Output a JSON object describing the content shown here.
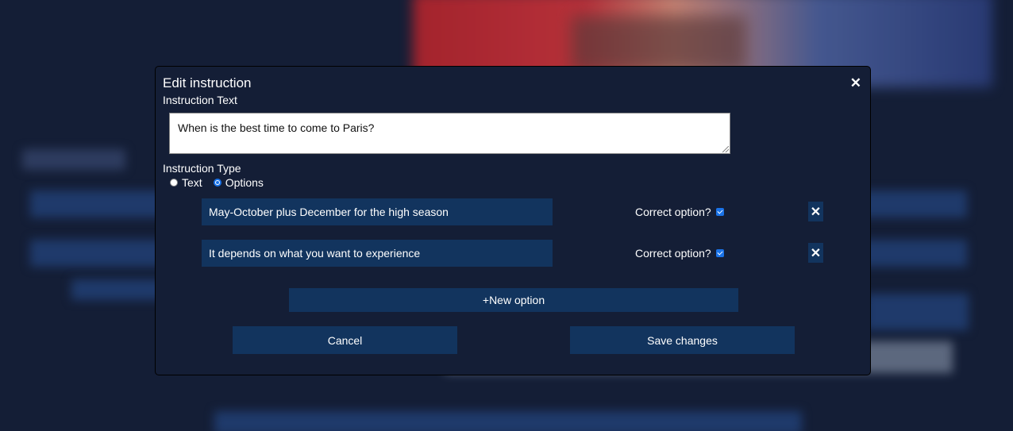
{
  "modal": {
    "title": "Edit instruction",
    "close_symbol": "✕",
    "instruction_text_label": "Instruction Text",
    "instruction_text_value": "When is the best time to come to Paris?",
    "instruction_type_label": "Instruction Type",
    "type_options": [
      {
        "label": "Text",
        "checked": false
      },
      {
        "label": "Options",
        "checked": true
      }
    ],
    "options": [
      {
        "value": "May-October plus December for the high season",
        "correct_label": "Correct option?",
        "correct": true,
        "remove_symbol": "✕"
      },
      {
        "value": "It depends on what you want to experience",
        "correct_label": "Correct option?",
        "correct": true,
        "remove_symbol": "✕"
      }
    ],
    "new_option_label": "+New option",
    "cancel_label": "Cancel",
    "save_label": "Save changes"
  },
  "colors": {
    "background": "#141e36",
    "button": "#12345e",
    "accent": "#1a73e8"
  },
  "icons": [
    "close-icon",
    "remove-option-icon"
  ]
}
